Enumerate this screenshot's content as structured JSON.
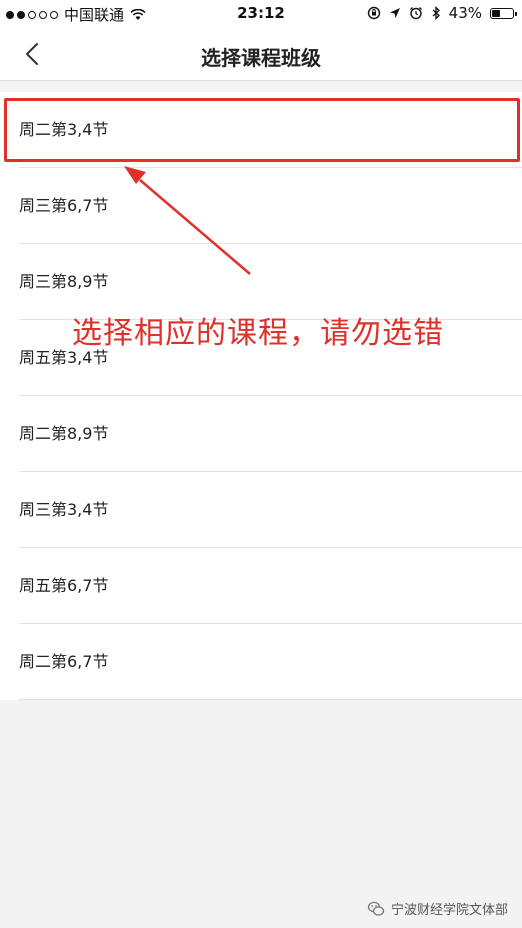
{
  "status_bar": {
    "carrier": "中国联通",
    "time": "23:12",
    "battery": "43%",
    "battery_level": 0.43,
    "icons": [
      "signal-dots-icon",
      "wifi-icon",
      "orientation-lock-icon",
      "location-icon",
      "alarm-icon",
      "bluetooth-icon",
      "battery-icon"
    ]
  },
  "nav": {
    "back_icon": "chevron-left-icon",
    "title": "选择课程班级"
  },
  "courses": [
    "周二第3,4节",
    "周三第6,7节",
    "周三第8,9节",
    "周五第3,4节",
    "周二第8,9节",
    "周三第3,4节",
    "周五第6,7节",
    "周二第6,7节"
  ],
  "annotation": {
    "text": "选择相应的课程，请勿选错",
    "color": "#e0302a"
  },
  "watermark": {
    "text": "宁波财经学院文体部",
    "icon": "wechat-logo-icon"
  }
}
